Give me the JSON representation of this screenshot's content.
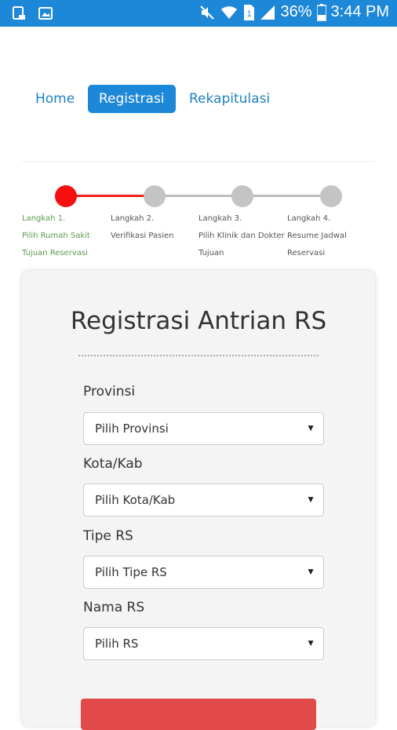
{
  "status_bar": {
    "battery_pct": "36%",
    "time": "3:44 PM",
    "left_icons": [
      "sd-card-icon",
      "image-icon"
    ],
    "right_icons": [
      "mute-icon",
      "wifi-icon",
      "sim-icon",
      "signal-icon",
      "battery-icon"
    ]
  },
  "nav": {
    "home": "Home",
    "registrasi": "Registrasi",
    "rekap": "Rekapitulasi",
    "active_color": "#1e88d8"
  },
  "steps": [
    {
      "label": "Langkah 1.\nPilih Rumah Sakit Tujuan Reservasi"
    },
    {
      "label": "Langkah 2.\nVerifikasi Pasien"
    },
    {
      "label": "Langkah 3.\nPilih Klinik dan Dokter Tujuan"
    },
    {
      "label": "Langkah 4.\nResume Jadwal Reservasi"
    }
  ],
  "form": {
    "title": "Registrasi Antrian RS",
    "fields": [
      {
        "label": "Provinsi",
        "value": "Pilih Provinsi"
      },
      {
        "label": "Kota/Kab",
        "value": "Pilih Kota/Kab"
      },
      {
        "label": "Tipe RS",
        "value": "Pilih Tipe RS"
      },
      {
        "label": "Nama RS",
        "value": "Pilih RS"
      }
    ]
  }
}
